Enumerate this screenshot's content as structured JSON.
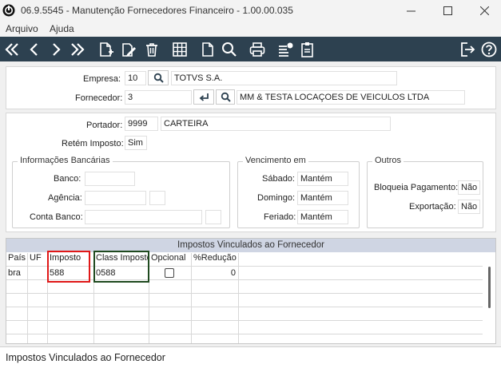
{
  "window": {
    "title": "06.9.5545 - Manutenção Fornecedores Financeiro - 1.00.00.035"
  },
  "menu": {
    "items": [
      "Arquivo",
      "Ajuda"
    ]
  },
  "toolbar": {
    "background": "#2d4150",
    "icons": [
      "first-icon",
      "previous-icon",
      "next-icon",
      "last-icon",
      "new-document-icon",
      "edit-icon",
      "delete-icon",
      "grid-icon",
      "document-icon",
      "search-icon",
      "print-icon",
      "list-filter-icon",
      "clipboard-icon",
      "exit-icon",
      "help-icon"
    ]
  },
  "header_panel": {
    "empresa": {
      "label": "Empresa:",
      "code": "10",
      "name": "TOTVS S.A."
    },
    "fornecedor": {
      "label": "Fornecedor:",
      "code": "3",
      "name": "MM & TESTA LOCAÇOES DE VEICULOS LTDA"
    }
  },
  "details_panel": {
    "portador": {
      "label": "Portador:",
      "code": "9999",
      "name": "CARTEIRA"
    },
    "retem_imposto": {
      "label": "Retém Imposto:",
      "value": "Sim"
    },
    "bancarias": {
      "title": "Informações Bancárias",
      "banco_label": "Banco:",
      "agencia_label": "Agência:",
      "conta_label": "Conta Banco:",
      "banco": "",
      "agencia": "",
      "agencia_dv": "",
      "conta": "",
      "conta_dv": ""
    },
    "vencimento": {
      "title": "Vencimento em",
      "sabado_label": "Sábado:",
      "sabado": "Mantém",
      "domingo_label": "Domingo:",
      "domingo": "Mantém",
      "feriado_label": "Feriado:",
      "feriado": "Mantém"
    },
    "outros": {
      "title": "Outros",
      "bloqueia_label": "Bloqueia Pagamento:",
      "bloqueia": "Não",
      "exportacao_label": "Exportação:",
      "exportacao": "Não"
    }
  },
  "grid": {
    "title": "Impostos Vinculados ao Fornecedor",
    "columns": [
      "País",
      "UF",
      "Imposto",
      "Class Imposto",
      "Opcional",
      "%Redução"
    ],
    "rows": [
      {
        "pais": "bra",
        "uf": "",
        "imposto": "588",
        "class_imposto": "0588",
        "opcional": false,
        "reducao": "0"
      }
    ],
    "highlight_colors": {
      "imposto": "#e01818",
      "class_imposto": "#1f4a1f"
    }
  },
  "status": {
    "text": "Impostos Vinculados ao Fornecedor"
  }
}
